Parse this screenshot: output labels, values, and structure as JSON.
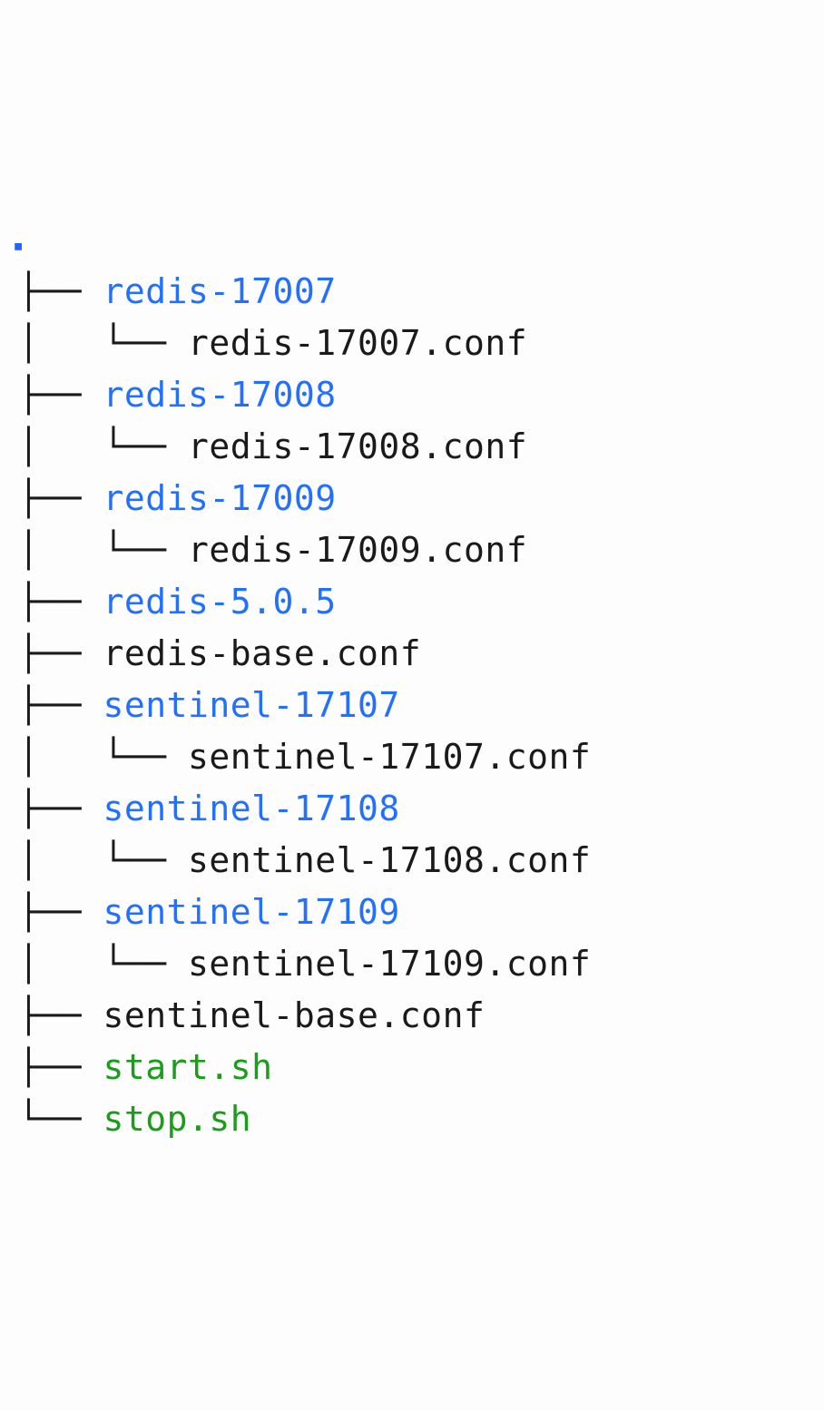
{
  "root_marker": "▪",
  "branches": {
    "tee": "├── ",
    "last": "└── ",
    "pipe": "│   ",
    "sub_last": "│   └── "
  },
  "tree": [
    {
      "prefix": "tee",
      "name": "redis-17007",
      "type": "dir"
    },
    {
      "prefix": "sub_last",
      "name": "redis-17007.conf",
      "type": "file"
    },
    {
      "prefix": "tee",
      "name": "redis-17008",
      "type": "dir"
    },
    {
      "prefix": "sub_last",
      "name": "redis-17008.conf",
      "type": "file"
    },
    {
      "prefix": "tee",
      "name": "redis-17009",
      "type": "dir"
    },
    {
      "prefix": "sub_last",
      "name": "redis-17009.conf",
      "type": "file"
    },
    {
      "prefix": "tee",
      "name": "redis-5.0.5",
      "type": "dir"
    },
    {
      "prefix": "tee",
      "name": "redis-base.conf",
      "type": "file"
    },
    {
      "prefix": "tee",
      "name": "sentinel-17107",
      "type": "dir"
    },
    {
      "prefix": "sub_last",
      "name": "sentinel-17107.conf",
      "type": "file"
    },
    {
      "prefix": "tee",
      "name": "sentinel-17108",
      "type": "dir"
    },
    {
      "prefix": "sub_last",
      "name": "sentinel-17108.conf",
      "type": "file"
    },
    {
      "prefix": "tee",
      "name": "sentinel-17109",
      "type": "dir"
    },
    {
      "prefix": "sub_last",
      "name": "sentinel-17109.conf",
      "type": "file"
    },
    {
      "prefix": "tee",
      "name": "sentinel-base.conf",
      "type": "file"
    },
    {
      "prefix": "tee",
      "name": "start.sh",
      "type": "exec"
    },
    {
      "prefix": "last",
      "name": "stop.sh",
      "type": "exec"
    }
  ]
}
